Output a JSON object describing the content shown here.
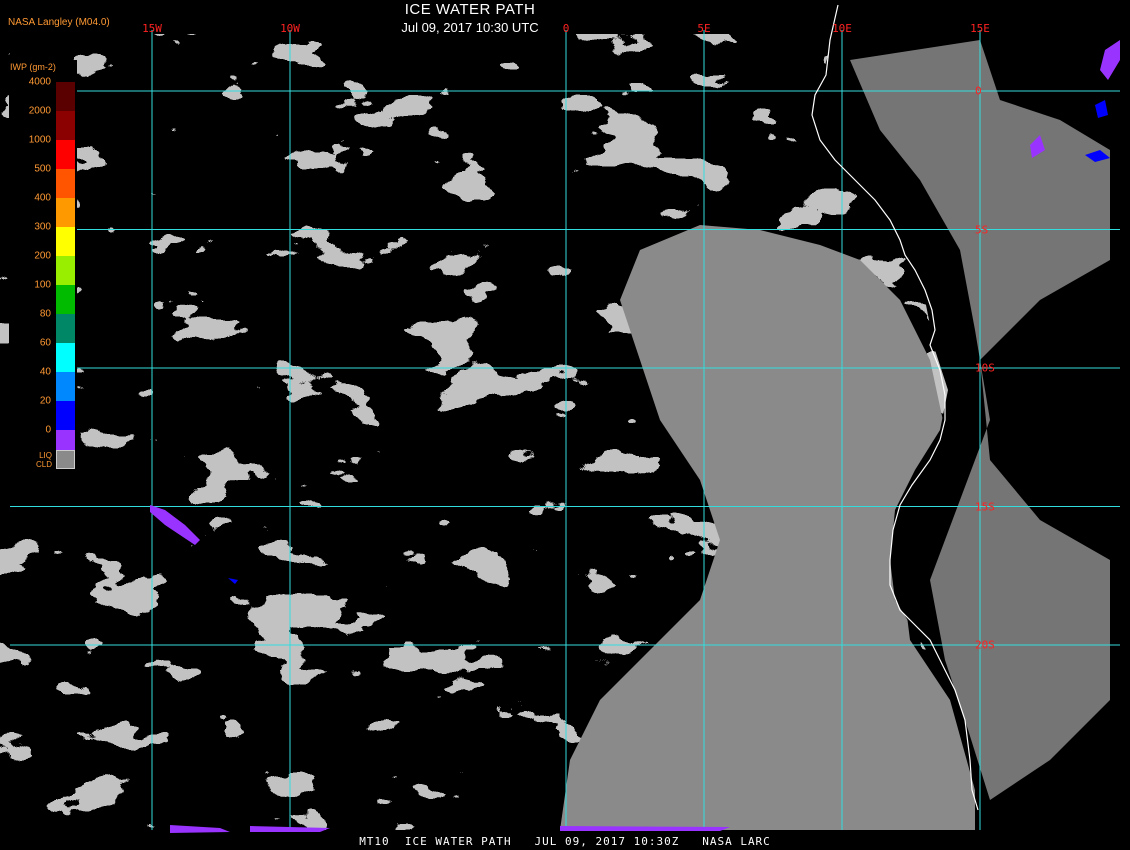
{
  "header": {
    "producer": "NASA Langley (M04.0)",
    "title": "ICE WATER PATH",
    "subtitle": "Jul 09, 2017 10:30 UTC"
  },
  "footer": "MT10  ICE WATER PATH   JUL 09, 2017 10:30Z   NASA LARC",
  "colors": {
    "background": "#000000",
    "liquid_cloud": "#8a8a8a",
    "grid": "#33dddd",
    "coast": "#ffffff",
    "labels": "#ff2222",
    "legend_text": "#ff9933"
  },
  "grid": {
    "lon_labels": [
      {
        "text": "15W",
        "lon": -15
      },
      {
        "text": "10W",
        "lon": -10
      },
      {
        "text": "0",
        "lon": 0
      },
      {
        "text": "5E",
        "lon": 5
      },
      {
        "text": "10E",
        "lon": 10
      },
      {
        "text": "15E",
        "lon": 15
      }
    ],
    "lat_labels": [
      {
        "text": "0",
        "lat": 0
      },
      {
        "text": "5S",
        "lat": -5
      },
      {
        "text": "10S",
        "lat": -10
      },
      {
        "text": "15S",
        "lat": -15
      },
      {
        "text": "20S",
        "lat": -20
      }
    ]
  },
  "legend": {
    "title": "IWP (gm-2)",
    "liq_label_1": "LIQ",
    "liq_label_2": "CLD",
    "bins": [
      {
        "label": "4000",
        "color": "#5a0000"
      },
      {
        "label": "2000",
        "color": "#8b0000"
      },
      {
        "label": "1000",
        "color": "#ff0000"
      },
      {
        "label": "500",
        "color": "#ff5500"
      },
      {
        "label": "400",
        "color": "#ff9900"
      },
      {
        "label": "300",
        "color": "#ffff00"
      },
      {
        "label": "200",
        "color": "#99ee00"
      },
      {
        "label": "100",
        "color": "#00bb00"
      },
      {
        "label": "80",
        "color": "#008866"
      },
      {
        "label": "60",
        "color": "#00ffff"
      },
      {
        "label": "40",
        "color": "#0088ff"
      },
      {
        "label": "20",
        "color": "#0000ff"
      },
      {
        "label": "0",
        "color": "#9933ff"
      }
    ]
  }
}
